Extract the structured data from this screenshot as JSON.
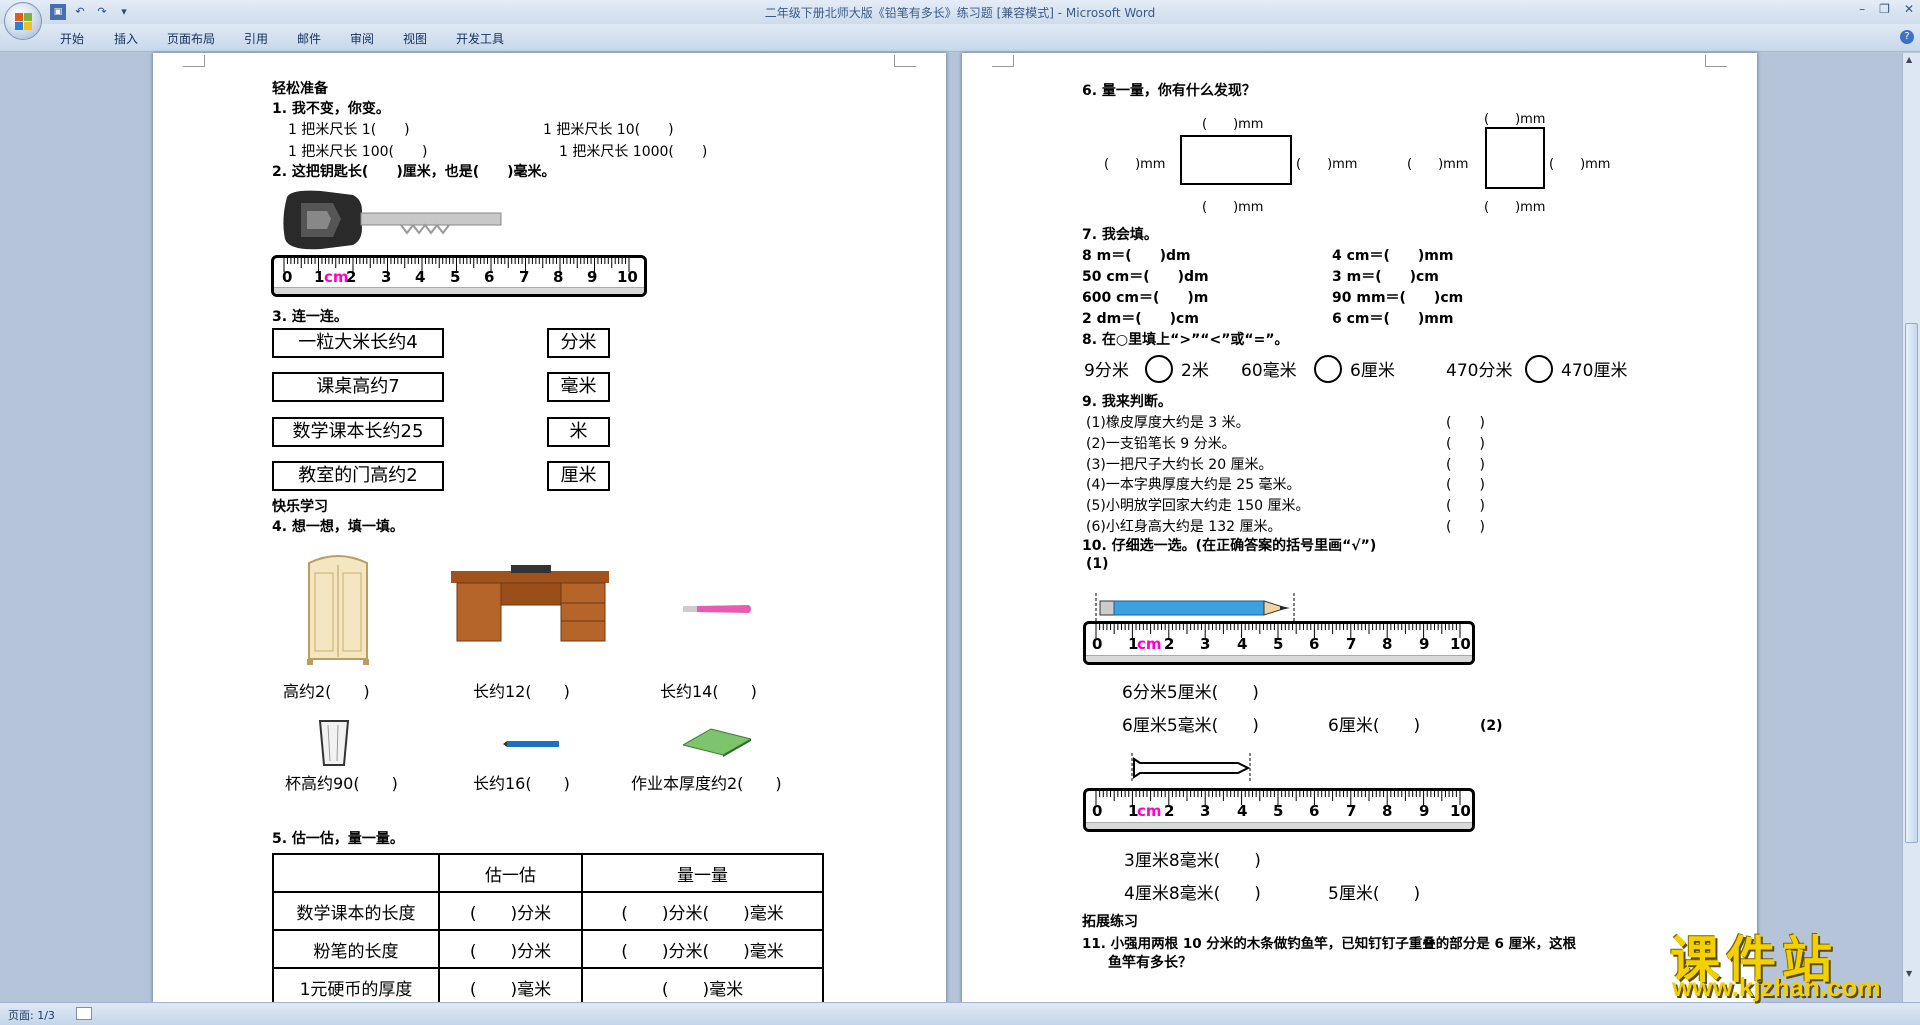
{
  "window": {
    "title": "二年级下册北师大版《铅笔有多长》练习题 [兼容模式] - Microsoft Word",
    "controls": [
      "–",
      "❐",
      "✕"
    ]
  },
  "ribbon_tabs": [
    "开始",
    "插入",
    "页面布局",
    "引用",
    "邮件",
    "审阅",
    "视图",
    "开发工具"
  ],
  "status": {
    "page": "页面: 1/3"
  },
  "watermark": {
    "text": "课件站",
    "url": "www.kjzhan.com"
  },
  "page1": {
    "s0": "轻松准备",
    "q1": "1. 我不变，你变。",
    "q1a": "1 把米尺长 1(　　)",
    "q1b": "1 把米尺长 10(　　)",
    "q1c": "1 把米尺长 100(　　)",
    "q1d": "1 把米尺长 1000(　　)",
    "q2": "2. 这把钥匙长(　　)厘米，也是(　　)毫米。",
    "ruler_nums": [
      "0",
      "1",
      "cm",
      "2",
      "3",
      "4",
      "5",
      "6",
      "7",
      "8",
      "9",
      "10"
    ],
    "q3": "3. 连一连。",
    "left_items": [
      "一粒大米长约4",
      "课桌高约7",
      "数学课本长约25",
      "教室的门高约2"
    ],
    "right_items": [
      "分米",
      "毫米",
      "米",
      "厘米"
    ],
    "s1": "快乐学习",
    "q4": "4. 想一想，填一填。",
    "pic_labels": [
      "高约2(　　)",
      "长约12(　　)",
      "长约14(　　)",
      "杯高约90(　　)",
      "长约16(　　)",
      "作业本厚度约2(　　)"
    ],
    "q5": "5. 估一估，量一量。",
    "table": {
      "headers": [
        "",
        "估一估",
        "量一量"
      ],
      "rows": [
        [
          "数学课本的长度",
          "(　　)分米",
          "(　　)分米(　　)毫米"
        ],
        [
          "粉笔的长度",
          "(　　)分米",
          "(　　)分米(　　)毫米"
        ],
        [
          "1元硬币的厚度",
          "(　　)毫米",
          "(　　)毫米"
        ]
      ]
    }
  },
  "page2": {
    "q6": "6. 量一量，你有什么发现？",
    "mm": "(　　)mm",
    "q7": "7. 我会填。",
    "fill": [
      [
        "8 m＝(　　)dm",
        "4 cm＝(　　)mm"
      ],
      [
        "50 cm＝(　　)dm",
        "3 m＝(　　)cm"
      ],
      [
        "600 cm＝(　　)m",
        "90 mm＝(　　)cm"
      ],
      [
        "2 dm＝(　　)cm",
        "6 cm＝(　　)mm"
      ]
    ],
    "q8": "8. 在○里填上“>”“<”或“=”。",
    "compare": [
      [
        "9分米",
        "2米"
      ],
      [
        "60毫米",
        "6厘米"
      ],
      [
        "470分米",
        "470厘米"
      ]
    ],
    "q9": "9. 我来判断。",
    "judge": [
      "(1)橡皮厚度大约是 3 米。",
      "(2)一支铅笔长 9 分米。",
      "(3)一把尺子大约长 20 厘米。",
      "(4)一本字典厚度大约是 25 毫米。",
      "(5)小明放学回家大约走 150 厘米。",
      "(6)小红身高大约是 132 厘米。"
    ],
    "paren": "(　　)",
    "q10": "10. 仔细选一选。(在正确答案的括号里画“√”)",
    "q10a": "(1)",
    "q10b": "(2)",
    "opt1a": "6分米5厘米(　　)",
    "opt1b": "6厘米5毫米(　　)",
    "opt1c": "6厘米(　　)",
    "opt2a": "3厘米8毫米(　　)",
    "opt2b": "4厘米8毫米(　　)",
    "opt2c": "5厘米(　　)",
    "s2": "拓展练习",
    "q11a": "11. 小强用两根 10 分米的木条做钓鱼竿，已知钉钉子重叠的部分是 6 厘米，这根",
    "q11b": "鱼竿有多长？"
  }
}
